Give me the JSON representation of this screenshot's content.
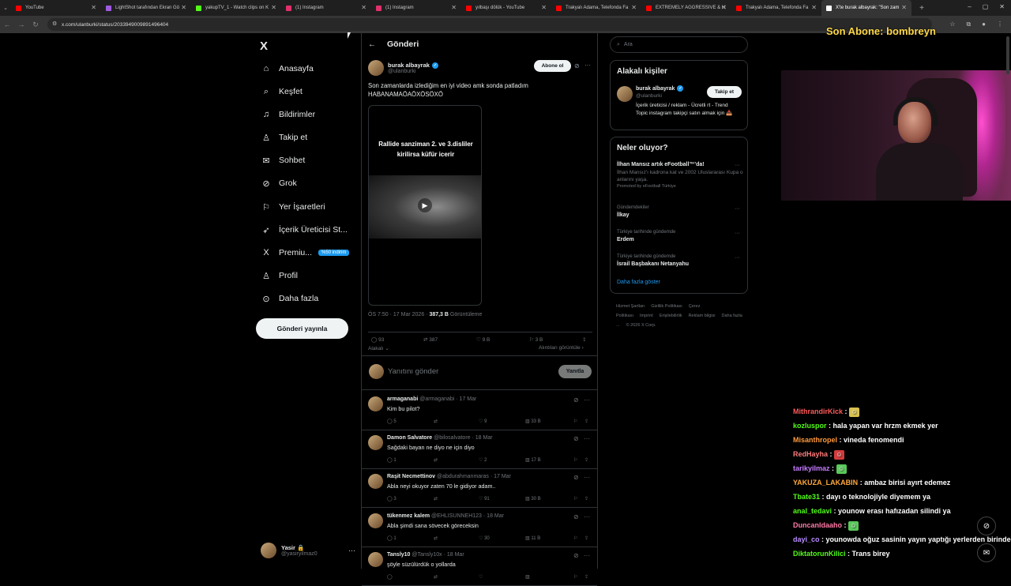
{
  "browser": {
    "tabs": [
      {
        "title": "YouTube",
        "color": "#ff0000"
      },
      {
        "title": "LightShot tarafından Ekran Gö",
        "color": "#a05ae0"
      },
      {
        "title": "yakupTV_1 - Watch clips on K",
        "color": "#53fc18"
      },
      {
        "title": "(1) Instagram",
        "color": "#e1306c"
      },
      {
        "title": "(1) Instagram",
        "color": "#e1306c"
      },
      {
        "title": "yılbaşı dölük - YouTube",
        "color": "#ff0000"
      },
      {
        "title": "Trakyalı Adama, Telefonda Fa",
        "color": "#ff0000"
      },
      {
        "title": "EXTREMELY AGGRESSIVE & H",
        "color": "#ff0000"
      },
      {
        "title": "Trakyalı Adama, Telefonda Fa",
        "color": "#ff0000"
      },
      {
        "title": "X'te burak albayrak: \"Son zam",
        "color": "#ffffff"
      }
    ],
    "url": "x.com/ulanburki/status/2033949009891496404"
  },
  "nav": {
    "logo": "X",
    "items": [
      {
        "label": "Anasayfa",
        "icon": "⌂"
      },
      {
        "label": "Keşfet",
        "icon": "⌕"
      },
      {
        "label": "Bildirimler",
        "icon": "♫"
      },
      {
        "label": "Takip et",
        "icon": "♙"
      },
      {
        "label": "Sohbet",
        "icon": "✉"
      },
      {
        "label": "Grok",
        "icon": "⊘"
      },
      {
        "label": "Yer İşaretleri",
        "icon": "⚐"
      },
      {
        "label": "İçerik Üreticisi St...",
        "icon": "➶"
      },
      {
        "label": "Premiu...",
        "icon": "X"
      },
      {
        "label": "Profil",
        "icon": "♙"
      },
      {
        "label": "Daha fazla",
        "icon": "⊙"
      }
    ],
    "premium_badge": "%50 indirim",
    "post_button": "Gönderi yayınla",
    "account_name": "Yasir",
    "account_handle": "@yasiryilmaz0"
  },
  "post": {
    "header": "Gönderi",
    "author_name": "burak albayrak",
    "author_handle": "@ulanburki",
    "follow_label": "Abone ol",
    "text": "Son zamanlarda izlediğim en iyi video amk sonda patladım HABANAMAÖAÖXÖSÖXÖ",
    "media_caption": "Rallide sanziman 2. ve 3.disliler kirilirsa küfür icerir",
    "time": "ÖS 7:50 · 17 Mar 2026 · ",
    "views": "387,3 B",
    "views_label": " Görüntüleme",
    "replies": "93",
    "reposts": "387",
    "likes": "9 B",
    "bookmarks": "3 B",
    "sort_label": "Alakalı",
    "sort_right": "Alıntıları görüntüle",
    "reply_placeholder": "Yanıtını gönder",
    "reply_button": "Yanıtla"
  },
  "replies": [
    {
      "name": "armaganabi",
      "handle": "@armaganabi · 17 Mar",
      "text": "Kim bu pilot?",
      "replies": "5",
      "likes": "9",
      "views": "33 B"
    },
    {
      "name": "Damon Salvatore",
      "handle": "@bilosalvatore · 18 Mar",
      "text": "Sağdaki bayan ne diyo ne için diyo",
      "replies": "1",
      "likes": "2",
      "views": "17 B"
    },
    {
      "name": "Raşit Necmettinov",
      "handle": "@abdurahmanmaras · 17 Mar",
      "text": "Abla neyi okuyor zaten 70 le gidiyor adam..",
      "replies": "3",
      "likes": "91",
      "views": "30 B"
    },
    {
      "name": "tükenmez kalem",
      "handle": "@EHLISUNNEH123 · 18 Mar",
      "text": "Abla şimdi sana sövecek göreceksin",
      "replies": "1",
      "likes": "30",
      "views": "11 B"
    },
    {
      "name": "Tansly10",
      "handle": "@Tansly10x · 18 Mar",
      "text": "şöyle süzülürdük o yollarda",
      "replies": "",
      "likes": "",
      "views": ""
    }
  ],
  "right": {
    "search_placeholder": "Ara",
    "who_title": "Alakalı kişiler",
    "who_name": "burak albayrak",
    "who_handle": "@ulanburki",
    "who_bio": "İçerik üreticisi / reklam - Ücretli rt - Trend Topic instagram takipçi satın almak için 📥",
    "who_follow": "Takip et",
    "trends_title": "Neler oluyor?",
    "trends": [
      {
        "context": "",
        "title": "İlhan Mansız artık eFootball™'da!",
        "desc": "İlhan Mansız'ı kadrona kat ve 2002 Uluslararası Kupa o anlarını yaşa.",
        "promo": "Promoted by eFootball Türkiye"
      },
      {
        "context": "Gündemdekiler",
        "title": "İlkay",
        "desc": "",
        "promo": ""
      },
      {
        "context": "Türkiye tarihinde gündemde",
        "title": "Erdem",
        "desc": "",
        "promo": ""
      },
      {
        "context": "Türkiye tarihinde gündemde",
        "title": "İsrail Başbakanı Netanyahu",
        "desc": "",
        "promo": ""
      }
    ],
    "show_more": "Daha fazla göster",
    "footer": [
      "Hizmet Şartları",
      "Gizlilik Politikası",
      "Çerez Politikası",
      "Imprint",
      "Erişilebilirlik",
      "Reklam bilgisi",
      "Daha fazla ...",
      "© 2026 X Corp."
    ]
  },
  "stream": {
    "subscriber_banner": "Son Abone: bombreyn",
    "chat": [
      {
        "user": "MithrandirKick",
        "color": "#ff5a5a",
        "msg": "",
        "emote": "#d8c050"
      },
      {
        "user": "kozluspor",
        "color": "#53fc18",
        "msg": "hala yapan var hrzm ekmek yer",
        "emote": ""
      },
      {
        "user": "Misanthropel",
        "color": "#ff9a3c",
        "msg": "vineda fenomendi",
        "emote": ""
      },
      {
        "user": "RedHayha",
        "color": "#ff7a7a",
        "msg": "",
        "emote": "#d23c3c"
      },
      {
        "user": "tarikyilmaz",
        "color": "#c77dff",
        "msg": "",
        "emote": "#5ac85a"
      },
      {
        "user": "YAKUZA_LAKABIN",
        "color": "#ffa83c",
        "msg": "ambaz birisi ayırt edemez",
        "emote": ""
      },
      {
        "user": "Tbate31",
        "color": "#53fc18",
        "msg": "dayı o teknolojiyle diyemem ya",
        "emote": ""
      },
      {
        "user": "anal_tedavi",
        "color": "#53fc18",
        "msg": "younow erası hafızadan silindi ya",
        "emote": ""
      },
      {
        "user": "Duncanldaaho",
        "color": "#ff7aa8",
        "msg": "",
        "emote": "#5ac85a"
      },
      {
        "user": "dayi_co",
        "color": "#b98cff",
        "msg": "younowda oğuz sasinin yayın yaptığı yerlerden birinde",
        "emote": ""
      },
      {
        "user": "DiktatorunKilici",
        "color": "#53fc18",
        "msg": "Trans birey",
        "emote": ""
      }
    ]
  },
  "colors": {
    "accent": "#1d9bf0",
    "banner": "#ffd84a"
  }
}
